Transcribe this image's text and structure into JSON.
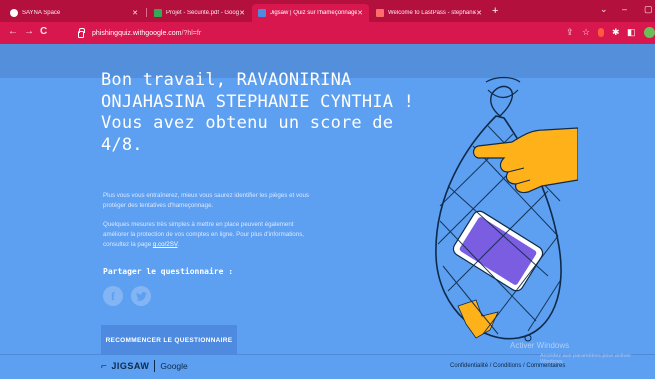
{
  "browser": {
    "tabs": [
      {
        "label": "SAYNA Space",
        "active": false,
        "fav_color": "#ffffff"
      },
      {
        "label": "Projet - Sécurité.pdf - Google D",
        "active": false,
        "fav_color": "#34a853"
      },
      {
        "label": "Jigsaw | Quiz sur l'hameçonnage",
        "active": true,
        "fav_color": "#4d8ae0"
      },
      {
        "label": "Welcome to LastPass - stephanie",
        "active": false,
        "fav_color": "#ff6c6c"
      }
    ],
    "new_tab": "+",
    "window_controls": [
      "⌄",
      "–",
      "▢"
    ],
    "nav": {
      "back": "←",
      "forward": "→",
      "reload": "C"
    },
    "url_host": "phishingquiz.withgoogle.com",
    "url_path": "/?hl=fr",
    "toolbar_icons": [
      "share-icon",
      "star-icon",
      "extension-icon",
      "puzzle-icon",
      "sidebar-icon",
      "profile-icon"
    ]
  },
  "result": {
    "headline": "Bon travail, RAVAONIRINA ONJAHASINA STEPHANIE CYNTHIA ! Vous avez obtenu un score de 4/8.",
    "paragraph1": "Plus vous vous entraînerez, mieux vous saurez identifier les pièges et vous protéger des tentatives d'hameçonnage.",
    "paragraph2_prefix": "Quelques mesures très simples à mettre en place peuvent également améliorer la protection de vos comptes en ligne. Pour plus d'informations, consultez la page ",
    "paragraph2_link": "g.co/2SV",
    "paragraph2_suffix": ".",
    "share_label": "Partager le questionnaire :",
    "social": [
      {
        "name": "facebook-icon",
        "glyph": "f"
      },
      {
        "name": "twitter-icon",
        "glyph": "t"
      }
    ],
    "restart_button": "RECOMMENCER LE QUESTIONNAIRE"
  },
  "footer": {
    "logo_jigsaw": "JIGSAW",
    "logo_google": "Google",
    "links": "Confidentialité / Conditions / Commentaires"
  },
  "overlay": {
    "watermark": "Activer Windows",
    "watermark_sub": "Accédez aux paramètres pour activer Windows."
  },
  "colors": {
    "tab_strip": "#b3103e",
    "toolbar": "#d8174e",
    "page_bg": "#5d9ff0",
    "button_bg": "#4d8ae0"
  }
}
